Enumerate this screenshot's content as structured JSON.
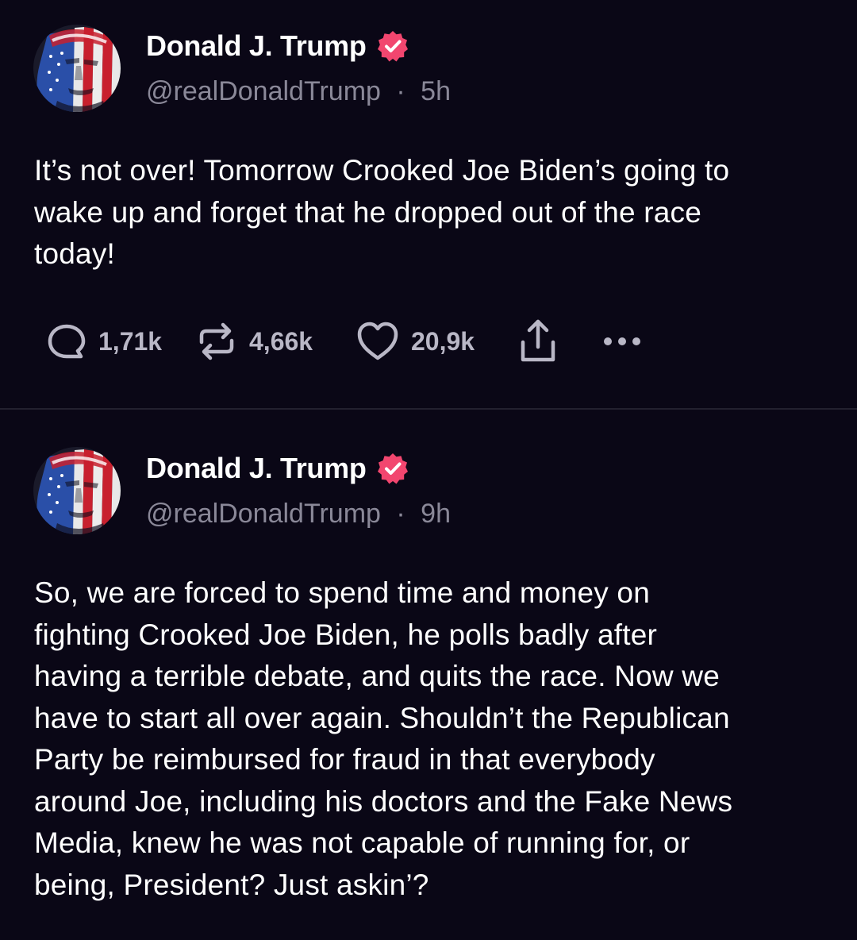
{
  "colors": {
    "background": "#0a0716",
    "text_primary": "#ffffff",
    "text_secondary": "#8a8898",
    "verified_badge": "#f2466f",
    "divider": "#23212f"
  },
  "posts": [
    {
      "author_name": "Donald J. Trump",
      "verified_icon": "verified-badge-icon",
      "handle": "@realDonaldTrump",
      "separator": "·",
      "time": "5h",
      "body_lines": [
        "It’s not over! Tomorrow Crooked Joe Biden’s going to",
        "wake up and forget that he dropped out of the race",
        "today!"
      ],
      "actions": {
        "replies": "1,71k",
        "reposts": "4,66k",
        "likes": "20,9k",
        "icons": [
          "reply-icon",
          "repost-icon",
          "like-icon",
          "share-icon",
          "more-icon"
        ]
      }
    },
    {
      "author_name": "Donald J. Trump",
      "verified_icon": "verified-badge-icon",
      "handle": "@realDonaldTrump",
      "separator": "·",
      "time": "9h",
      "body_lines": [
        "So, we are forced to spend time and money on",
        "fighting Crooked Joe Biden, he polls badly after",
        "having a terrible debate, and quits the race. Now we",
        "have to start all over again. Shouldn’t the Republican",
        "Party be reimbursed for fraud in that everybody",
        "around Joe, including his doctors and the Fake News",
        "Media, knew he was not capable of running for, or",
        "being, President?  Just askin’?"
      ]
    }
  ]
}
